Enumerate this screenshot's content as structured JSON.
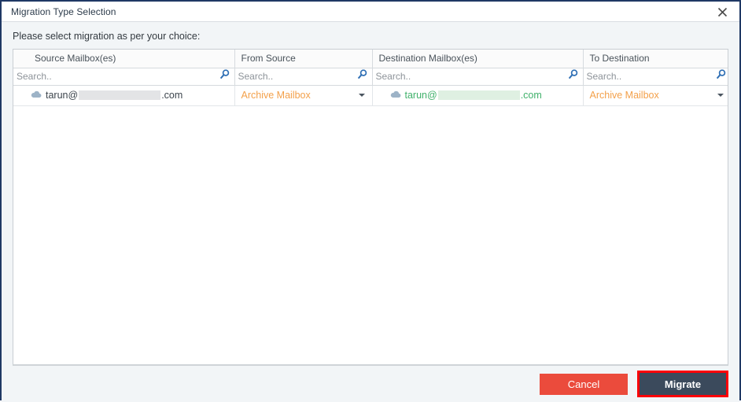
{
  "window": {
    "title": "Migration Type Selection",
    "close_icon": "close-icon"
  },
  "instruction": "Please select migration as per your choice:",
  "grid": {
    "columns": [
      {
        "key": "source_mailboxes",
        "label": "Source Mailbox(es)"
      },
      {
        "key": "from_source",
        "label": "From Source"
      },
      {
        "key": "destination_mailboxes",
        "label": "Destination Mailbox(es)"
      },
      {
        "key": "to_destination",
        "label": "To Destination"
      }
    ],
    "search_row": {
      "source_placeholder": "Search..",
      "source_value": "",
      "from_placeholder": "Search..",
      "from_value": "",
      "destination_placeholder": "Search..",
      "destination_value": "",
      "to_placeholder": "Search..",
      "to_value": "",
      "search_icon": "search-icon"
    },
    "rows": [
      {
        "source_prefix": "tarun@",
        "source_suffix": ".com",
        "source_redacted": true,
        "from_source": "Archive Mailbox",
        "destination_prefix": "tarun@",
        "destination_suffix": ".com",
        "destination_redacted": true,
        "to_destination": "Archive Mailbox",
        "cloud_icon": "cloud-icon",
        "dropdown_icon": "chevron-down-icon"
      }
    ]
  },
  "footer": {
    "cancel_label": "Cancel",
    "migrate_label": "Migrate"
  },
  "colors": {
    "window_border": "#1f3864",
    "background": "#f2f5f7",
    "cancel_red": "#eb4b3c",
    "migrate_navy": "#3b4a5c",
    "highlight_red": "#fb0007",
    "dropdown_orange": "#f3a04a",
    "destination_green": "#3fb06a",
    "search_icon_blue": "#2f6fb5"
  }
}
